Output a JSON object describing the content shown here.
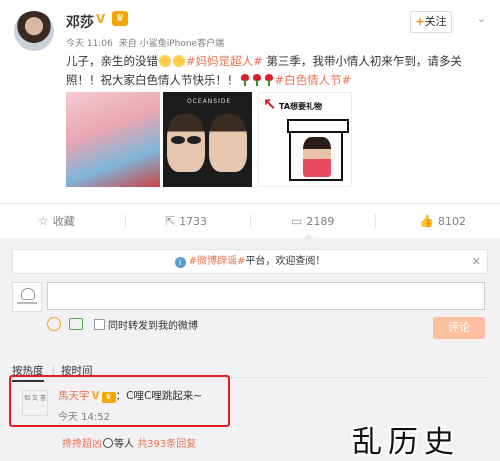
{
  "post": {
    "author": "邓莎",
    "follow_label": "关注",
    "follow_plus": "+",
    "time": "今天 11:06",
    "source_prefix": "来自",
    "source": "小鲨鱼iPhone客户端",
    "text_part1": "儿子，亲生的没错",
    "hashtag1": "#妈妈是超人#",
    "text_part2": "第三季，我带小情人初来乍到，请多关照！！祝大家白色情人节快乐！！",
    "hashtag2": "#白色情人节#",
    "photo2_caption": "OCEANSIDE",
    "photo3_caption": "TA想要礼物"
  },
  "actions": [
    {
      "icon": "bookmark-icon",
      "label": "收藏"
    },
    {
      "icon": "repost-icon",
      "label": "1733"
    },
    {
      "icon": "comment-icon",
      "label": "2189"
    },
    {
      "icon": "like-icon",
      "label": "8102"
    }
  ],
  "comment_box": {
    "notice_hashtag": "#微博辟谣#",
    "notice_text": "平台，欢迎查阅！",
    "notice_close": "✕",
    "input_value": "",
    "repost_checkbox_label": "同时转发到我的微博",
    "submit_label": "评论"
  },
  "sort": {
    "by_hot": "按热度",
    "by_time": "按时间"
  },
  "comment": {
    "author": "馬天宇",
    "text": "：C哩C哩跳起来~",
    "time": "今天 14:52",
    "avatar_text": "但 又 書"
  },
  "replies": {
    "users": "搀搀超凶",
    "suffix": "等人",
    "count_text": "共393条回复"
  },
  "watermark": "乱历史",
  "colors": {
    "accent": "#eb7350",
    "follow_plus": "#ff8200",
    "highlight_border": "#e02020",
    "submit_bg": "#ffc09f",
    "vip_badge": "#f0a800"
  }
}
